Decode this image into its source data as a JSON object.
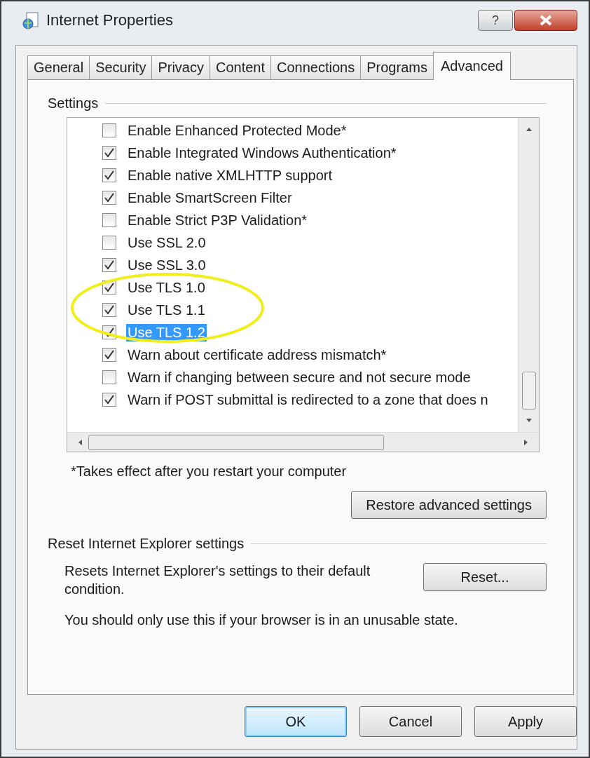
{
  "window": {
    "title": "Internet Properties",
    "help_button": "?"
  },
  "tabs": [
    {
      "label": "General",
      "selected": false
    },
    {
      "label": "Security",
      "selected": false
    },
    {
      "label": "Privacy",
      "selected": false
    },
    {
      "label": "Content",
      "selected": false
    },
    {
      "label": "Connections",
      "selected": false
    },
    {
      "label": "Programs",
      "selected": false
    },
    {
      "label": "Advanced",
      "selected": true
    }
  ],
  "settings": {
    "label": "Settings",
    "items": [
      {
        "label": "Enable Enhanced Protected Mode*",
        "checked": false,
        "selected": false
      },
      {
        "label": "Enable Integrated Windows Authentication*",
        "checked": true,
        "selected": false
      },
      {
        "label": "Enable native XMLHTTP support",
        "checked": true,
        "selected": false
      },
      {
        "label": "Enable SmartScreen Filter",
        "checked": true,
        "selected": false
      },
      {
        "label": "Enable Strict P3P Validation*",
        "checked": false,
        "selected": false
      },
      {
        "label": "Use SSL 2.0",
        "checked": false,
        "selected": false
      },
      {
        "label": "Use SSL 3.0",
        "checked": true,
        "selected": false
      },
      {
        "label": "Use TLS 1.0",
        "checked": true,
        "selected": false
      },
      {
        "label": "Use TLS 1.1",
        "checked": true,
        "selected": false
      },
      {
        "label": "Use TLS 1.2",
        "checked": true,
        "selected": true
      },
      {
        "label": "Warn about certificate address mismatch*",
        "checked": true,
        "selected": false
      },
      {
        "label": "Warn if changing between secure and not secure mode",
        "checked": false,
        "selected": false
      },
      {
        "label": "Warn if POST submittal is redirected to a zone that does n",
        "checked": true,
        "selected": false
      }
    ],
    "footnote": "*Takes effect after you restart your computer",
    "restore_button": "Restore advanced settings"
  },
  "reset": {
    "label": "Reset Internet Explorer settings",
    "description": "Resets Internet Explorer's settings to their default condition.",
    "button": "Reset...",
    "note": "You should only use this if your browser is in an unusable state."
  },
  "buttons": [
    {
      "label": "OK",
      "default": true
    },
    {
      "label": "Cancel",
      "default": false
    },
    {
      "label": "Apply",
      "default": false
    }
  ]
}
